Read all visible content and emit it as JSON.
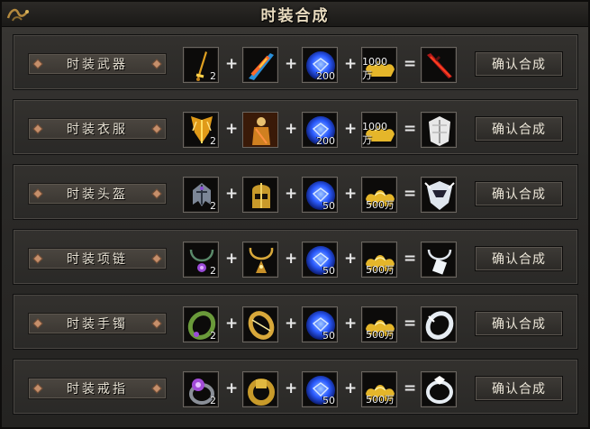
{
  "window": {
    "title": "时装合成"
  },
  "rows": [
    {
      "label": "时装武器",
      "item_icon": "fashion-weapon-icon",
      "item_qty": "2",
      "material_icon": "fire-blade-icon",
      "gem_qty": "200",
      "gold_qty": "1000万",
      "result_icon": "crimson-weapon-icon",
      "button": "确认合成"
    },
    {
      "label": "时装衣服",
      "item_icon": "fashion-clothes-icon",
      "item_qty": "2",
      "material_icon": "warrior-figure-icon",
      "gem_qty": "200",
      "gold_qty": "1000万",
      "result_icon": "white-armor-icon",
      "button": "确认合成"
    },
    {
      "label": "时装头盔",
      "item_icon": "fashion-helmet-icon",
      "item_qty": "2",
      "material_icon": "golden-helmet-icon",
      "gem_qty": "50",
      "gold_qty": "500万",
      "result_icon": "silver-helmet-icon",
      "button": "确认合成"
    },
    {
      "label": "时装项链",
      "item_icon": "fashion-necklace-icon",
      "item_qty": "2",
      "material_icon": "golden-necklace-icon",
      "gem_qty": "50",
      "gold_qty": "500万",
      "result_icon": "silver-necklace-icon",
      "button": "确认合成"
    },
    {
      "label": "时装手镯",
      "item_icon": "fashion-bracelet-icon",
      "item_qty": "2",
      "material_icon": "golden-bracelet-icon",
      "gem_qty": "50",
      "gold_qty": "500万",
      "result_icon": "silver-bracelet-icon",
      "button": "确认合成"
    },
    {
      "label": "时装戒指",
      "item_icon": "fashion-ring-icon",
      "item_qty": "2",
      "material_icon": "golden-ring-icon",
      "gem_qty": "50",
      "gold_qty": "500万",
      "result_icon": "silver-ring-icon",
      "button": "确认合成"
    }
  ],
  "operators": {
    "plus": "+",
    "equals": "="
  },
  "icons": {
    "gem": "blue-gem-icon",
    "gold": "gold-ingot-icon"
  },
  "colors": {
    "accent": "#c58f6b",
    "panel": "#2b2a28",
    "text": "#e6e0d2",
    "gem": "#2c5cff",
    "gold": "#e5b62a"
  }
}
